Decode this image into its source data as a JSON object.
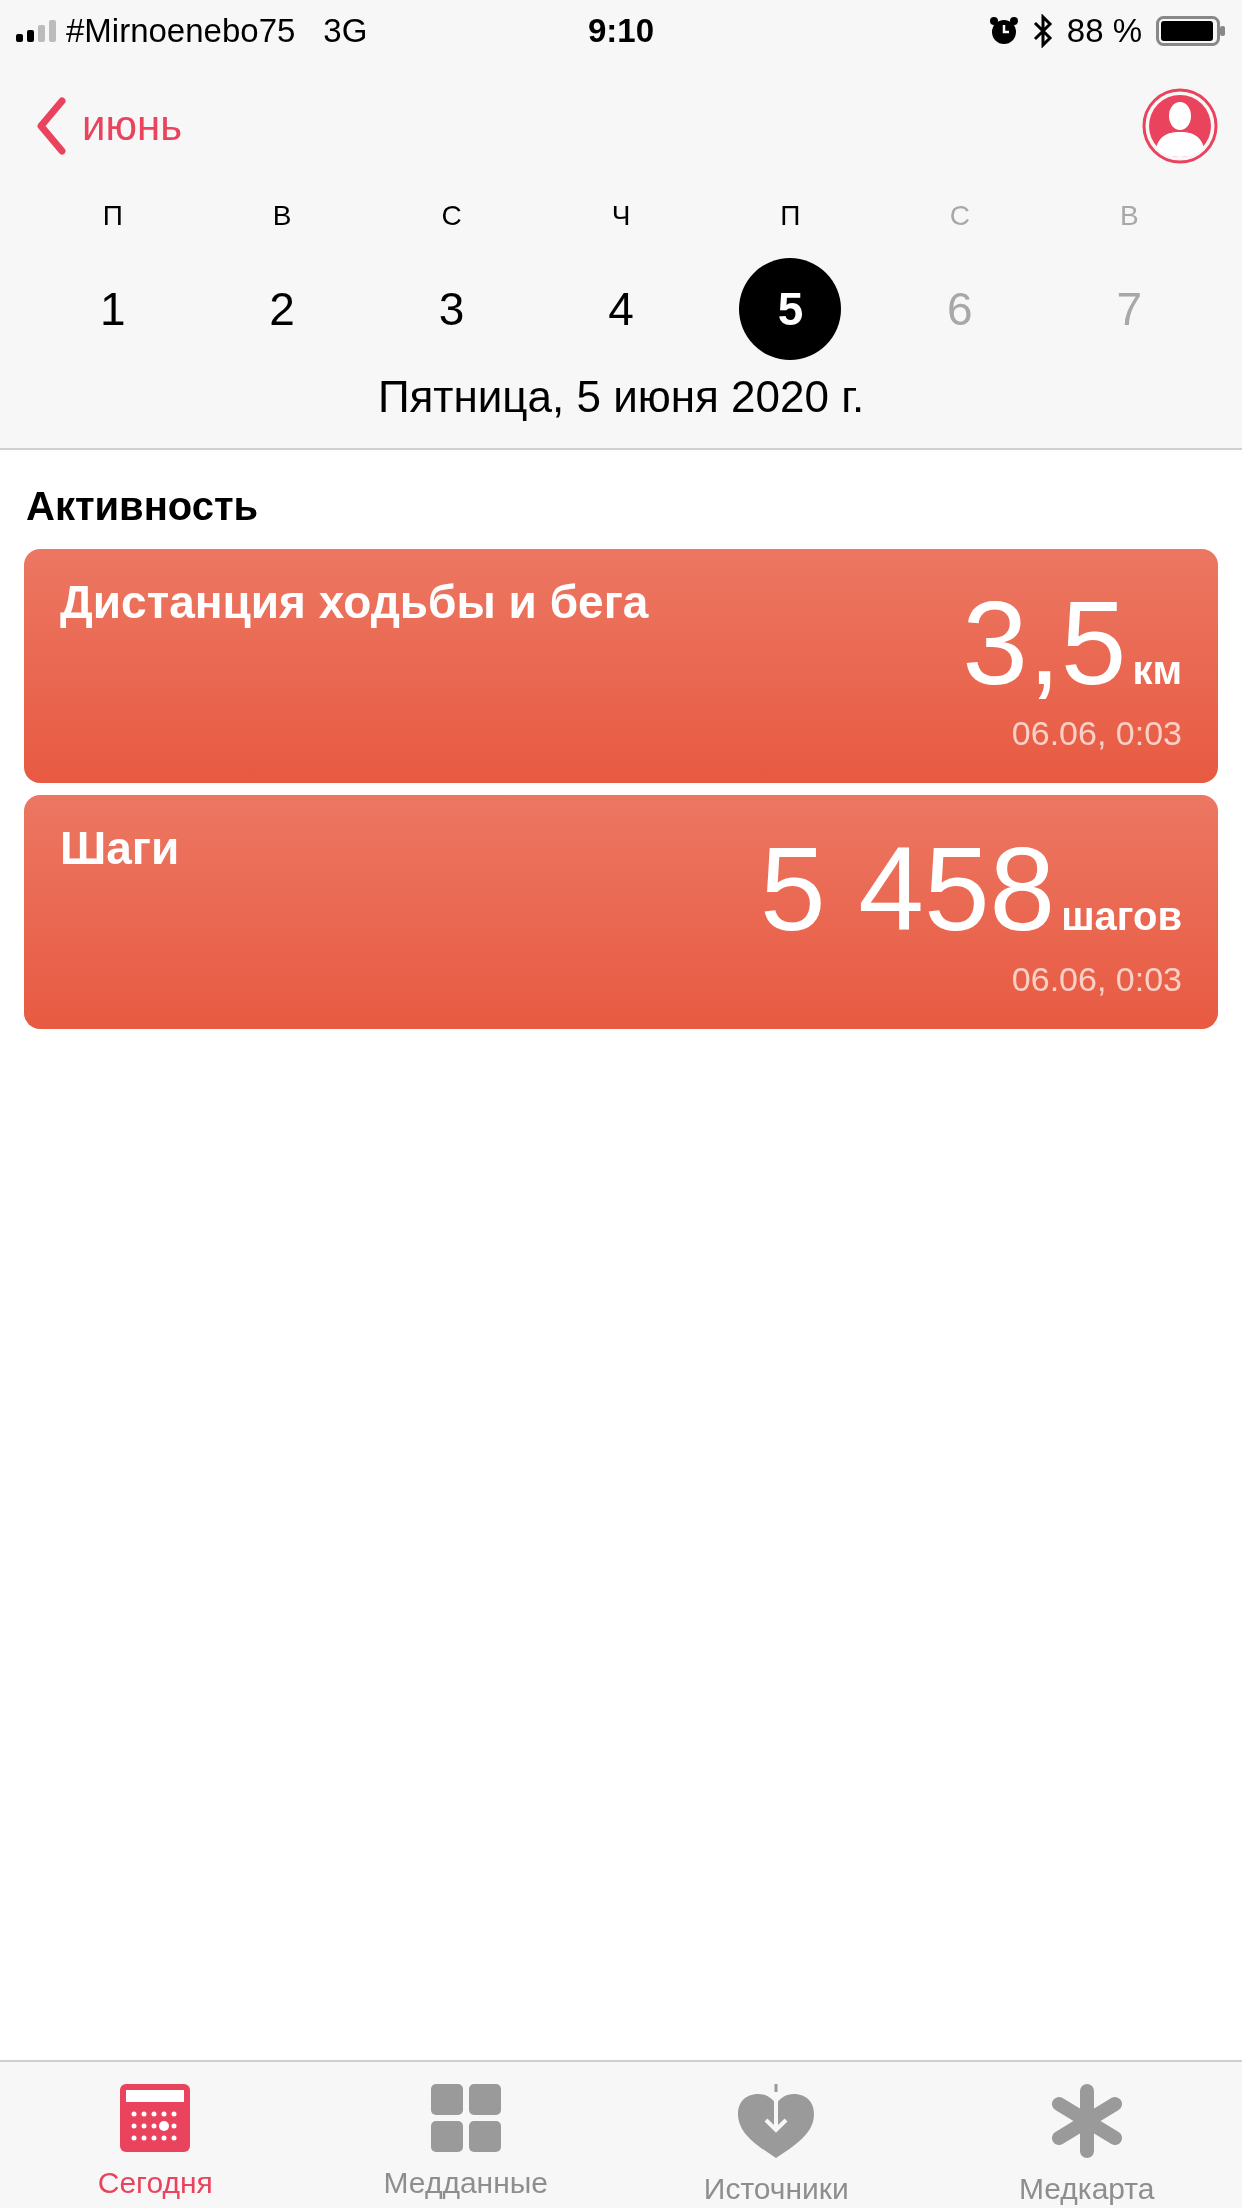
{
  "status_bar": {
    "carrier": "#Mirnoenebo75",
    "network": "3G",
    "time": "9:10",
    "battery": "88 %"
  },
  "header": {
    "back_label": "июнь"
  },
  "week": [
    {
      "weekday": "П",
      "day": "1",
      "selected": false,
      "dimmed": false
    },
    {
      "weekday": "В",
      "day": "2",
      "selected": false,
      "dimmed": false
    },
    {
      "weekday": "С",
      "day": "3",
      "selected": false,
      "dimmed": false
    },
    {
      "weekday": "Ч",
      "day": "4",
      "selected": false,
      "dimmed": false
    },
    {
      "weekday": "П",
      "day": "5",
      "selected": true,
      "dimmed": false
    },
    {
      "weekday": "С",
      "day": "6",
      "selected": false,
      "dimmed": true
    },
    {
      "weekday": "В",
      "day": "7",
      "selected": false,
      "dimmed": true
    }
  ],
  "date_line": "Пятница, 5 июня 2020 г.",
  "section_title": "Активность",
  "cards": [
    {
      "title": "Дистанция ходьбы и бега",
      "value": "3,5",
      "unit": "км",
      "time": "06.06, 0:03"
    },
    {
      "title": "Шаги",
      "value": "5 458",
      "unit": "шагов",
      "time": "06.06, 0:03"
    }
  ],
  "tab_bar": [
    {
      "kind": "today",
      "label": "Сегодня",
      "selected": true
    },
    {
      "kind": "data",
      "label": "Медданные",
      "selected": false
    },
    {
      "kind": "sources",
      "label": "Источники",
      "selected": false
    },
    {
      "kind": "medical",
      "label": "Медкарта",
      "selected": false
    }
  ]
}
